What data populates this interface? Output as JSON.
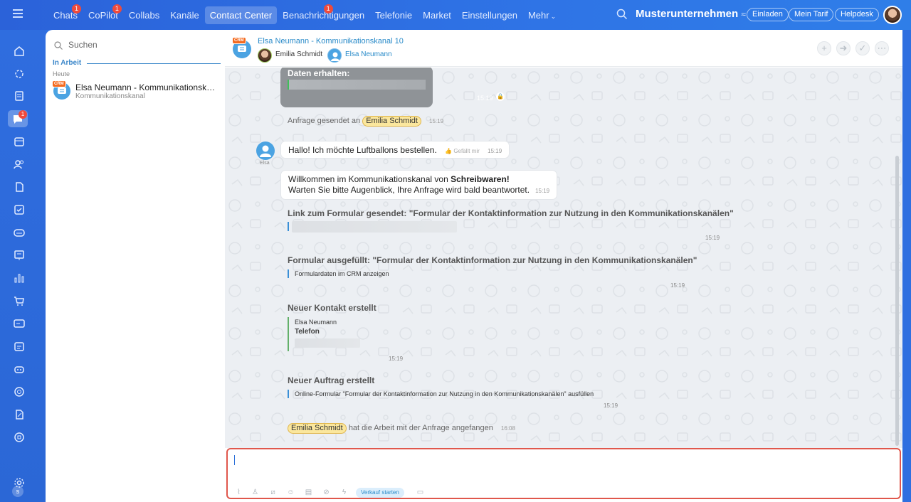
{
  "topnav": {
    "items": [
      {
        "label": "Chats",
        "badge": "1"
      },
      {
        "label": "CoPilot",
        "badge": "1"
      },
      {
        "label": "Collabs",
        "badge": ""
      },
      {
        "label": "Kanäle",
        "badge": ""
      },
      {
        "label": "Contact Center",
        "badge": "",
        "active": true
      },
      {
        "label": "Benachrichtigungen",
        "badge": "1"
      },
      {
        "label": "Telefonie",
        "badge": ""
      },
      {
        "label": "Market",
        "badge": ""
      },
      {
        "label": "Einstellungen",
        "badge": ""
      }
    ],
    "more_label": "Mehr",
    "company": "Musterunternehmen",
    "invite_label": "Einladen",
    "tariff_label": "Mein Tarif",
    "helpdesk_label": "Helpdesk"
  },
  "leftbar": {
    "items": [
      "home-icon",
      "copilot-icon",
      "feed-icon",
      "chat-icon",
      "calendar-icon",
      "contacts-icon",
      "documents-icon",
      "tasks-icon",
      "crm-icon",
      "sites-icon",
      "analytics-icon",
      "shop-icon",
      "cards-icon",
      "booking-icon",
      "bot-icon",
      "marketing-icon",
      "sign-icon",
      "automation-icon",
      "avatar-small",
      "settings-icon"
    ],
    "chat_badge": "1",
    "user_initial": "s"
  },
  "sidebar": {
    "search_placeholder": "Suchen",
    "section_label": "In Arbeit",
    "day_label": "Heute",
    "chat_items": [
      {
        "title": "Elsa Neumann - Kommunikationskan...",
        "subtitle": "Kommunikationskanal",
        "tag": "CRM"
      }
    ]
  },
  "chat_header": {
    "tag": "CRM",
    "title": "Elsa Neumann - Kommunikationskanal 10",
    "participant_1": "Emilia Schmidt",
    "participant_2": "Elsa Neumann"
  },
  "messages": {
    "data_card_title": "Daten erhalten:",
    "data_card_time": "15:19",
    "request_sent_prefix": "Anfrage gesendet an",
    "request_sent_to": "Emilia Schmidt",
    "request_sent_time": "15:19",
    "avatar_label": "Elsa",
    "greeting_text": "Hallo! Ich möchte Luftballons bestellen.",
    "greeting_like": "Gefällt mir",
    "greeting_time": "15:19",
    "welcome_line_1_prefix": "Willkommen im Kommunikationskanal von",
    "welcome_line_1_bold": "Schreibwaren!",
    "welcome_line_2": "Warten Sie bitte Augenblick, Ihre Anfrage wird bald beantwortet.",
    "welcome_time": "15:19",
    "form_link_title": "Link zum Formular gesendet: \"Formular der Kontaktinformation zur Nutzung in den Kommunikationskanälen\"",
    "form_link_time": "15:19",
    "form_filled_title": "Formular ausgefüllt: \"Formular der Kontaktinformation zur Nutzung in den Kommunikationskanälen\"",
    "form_filled_link": "Formulardaten im CRM anzeigen",
    "form_filled_time": "15:19",
    "contact_title": "Neuer Kontakt erstellt",
    "contact_name": "Elsa Neumann",
    "contact_phone_label": "Telefon",
    "contact_time": "15:19",
    "order_title": "Neuer Auftrag erstellt",
    "order_text": "Online-Formular \"Formular der Kontaktinformation zur Nutzung in den Kommunikationskanälen\" ausfüllen",
    "order_time": "15:19",
    "started_by": "Emilia Schmidt",
    "started_text": "hat die Arbeit mit der Anfrage angefangen",
    "started_time": "16:08"
  },
  "composer": {
    "value": "",
    "sale_label": "Verkauf starten"
  },
  "colors": {
    "accent": "#2f6fe0",
    "link": "#2a8bc9",
    "badge": "#ef4a3b",
    "mention_bg": "#fbe79d",
    "composer_border": "#e0574c"
  }
}
